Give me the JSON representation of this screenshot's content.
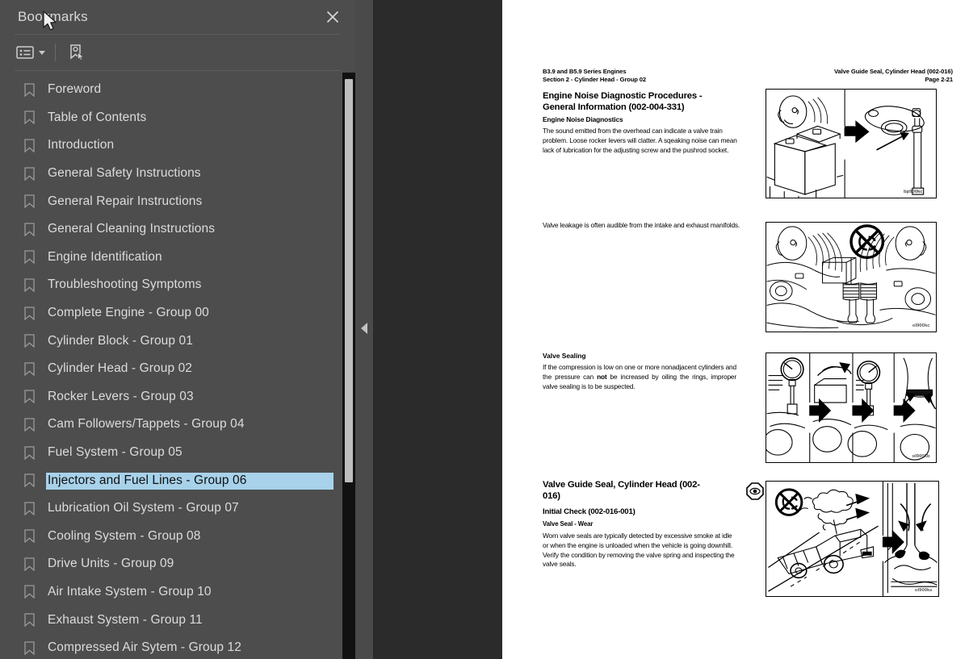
{
  "panel": {
    "title": "Bookmarks",
    "close_label": "×",
    "toolbar": {
      "options_icon": "list-options-icon",
      "options_caret": "chevron-down-icon",
      "new_bookmark_icon": "bookmark-pointer-icon"
    },
    "items": [
      {
        "label": "Foreword",
        "selected": false
      },
      {
        "label": "Table of Contents",
        "selected": false
      },
      {
        "label": "Introduction",
        "selected": false
      },
      {
        "label": "General Safety Instructions",
        "selected": false
      },
      {
        "label": "General Repair Instructions",
        "selected": false
      },
      {
        "label": "General Cleaning Instructions",
        "selected": false
      },
      {
        "label": "Engine Identification",
        "selected": false
      },
      {
        "label": "Troubleshooting Symptoms",
        "selected": false
      },
      {
        "label": "Complete Engine - Group 00",
        "selected": false
      },
      {
        "label": "Cylinder Block - Group 01",
        "selected": false
      },
      {
        "label": "Cylinder Head - Group 02",
        "selected": false
      },
      {
        "label": "Rocker Levers - Group 03",
        "selected": false
      },
      {
        "label": "Cam Followers/Tappets - Group 04",
        "selected": false
      },
      {
        "label": "Fuel System - Group 05",
        "selected": false
      },
      {
        "label": "Injectors and Fuel Lines - Group 06",
        "selected": true
      },
      {
        "label": "Lubrication Oil System - Group 07",
        "selected": false
      },
      {
        "label": "Cooling System - Group 08",
        "selected": false
      },
      {
        "label": "Drive Units - Group 09",
        "selected": false
      },
      {
        "label": "Air Intake System - Group 10",
        "selected": false
      },
      {
        "label": "Exhaust System - Group 11",
        "selected": false
      },
      {
        "label": "Compressed Air Sytem - Group 12",
        "selected": false
      }
    ],
    "colors": {
      "panel_bg": "#4d4d4d",
      "selection_bg": "#a8d2ea",
      "text": "#dcdcdc",
      "scrollbar_track": "#111111",
      "scrollbar_thumb": "#bdbdbd"
    }
  },
  "splitter": {
    "collapse_icon": "triangle-left-icon"
  },
  "document": {
    "header_left_line1": "B3.9 and B5.9 Series Engines",
    "header_left_line2": "Section 2 - Cylinder Head - Group 02",
    "header_right_line1": "Valve Guide Seal, Cylinder Head (002-016)",
    "header_right_line2": "Page 2-21",
    "heading_main": "Engine Noise Diagnostic Procedures - General Information (002-004-331)",
    "subheading_1": "Engine Noise Diagnostics",
    "paragraph_1": "The sound emitted from the overhead can indicate a valve train problem. Loose rocker levers will clatter. A sqeaking noise can mean lack of lubrication for the adjusting screw and the pushrod socket.",
    "paragraph_2": "Valve leakage is often audible from the intake and exhaust manifolds.",
    "subheading_2": "Valve Sealing",
    "paragraph_3_part1": "If the compression is low on one or more nonadjacent cylinders and the pressure can ",
    "paragraph_3_bold": "not",
    "paragraph_3_part2": " be increased by oiling the rings, improper valve sealing is to be suspected.",
    "heading_valve_guide": "Valve Guide Seal, Cylinder Head (002-016)",
    "subheading_initial_check": "Initial Check (002-016-001)",
    "subheading_valve_seal_wear": "Valve Seal - Wear",
    "paragraph_4": "Worn valve seals are typically detected by excessive smoke at idle or when the engine is unloaded when the vehicle is going downhill. Verify the condition by removing the valve spring and inspecting the valve seals.",
    "inspection_icon": "eye-inspection-icon",
    "figures": [
      {
        "name": "figure-rocker-lever-noise",
        "code": "bp900kc"
      },
      {
        "name": "figure-valve-leakage-listening",
        "code": "ol900kc"
      },
      {
        "name": "figure-compression-test-sequence",
        "code": "ol900kb"
      },
      {
        "name": "figure-truck-smoke-valve-seal",
        "code": "ol900ks"
      }
    ]
  },
  "cursor": {
    "icon": "mouse-arrow-cursor"
  }
}
